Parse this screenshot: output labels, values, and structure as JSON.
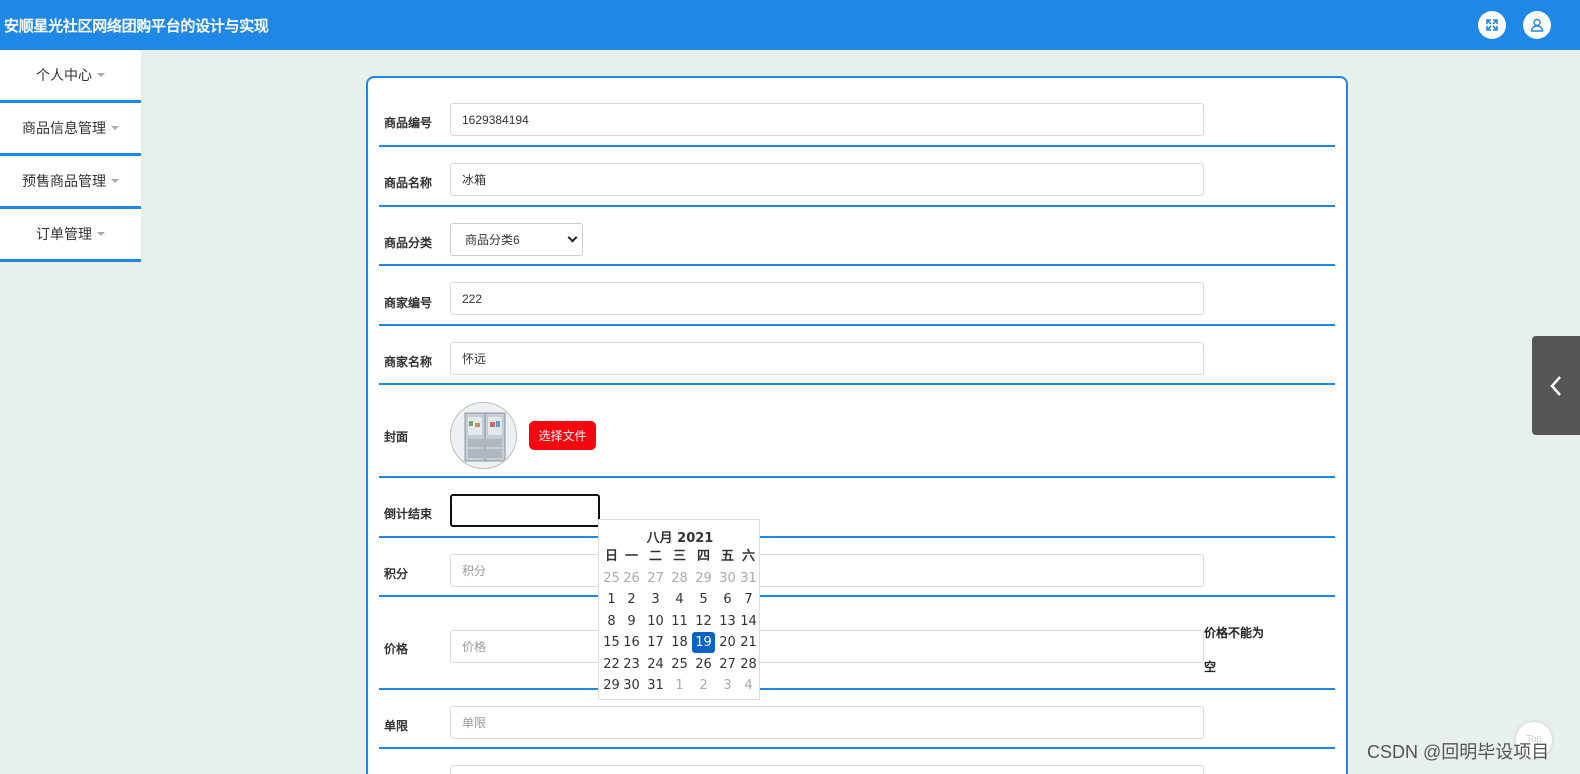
{
  "header": {
    "title": "安顺星光社区网络团购平台的设计与实现"
  },
  "sidebar": {
    "items": [
      {
        "label": "个人中心"
      },
      {
        "label": "商品信息管理"
      },
      {
        "label": "预售商品管理"
      },
      {
        "label": "订单管理"
      }
    ]
  },
  "form": {
    "product_code": {
      "label": "商品编号",
      "value": "1629384194"
    },
    "product_name": {
      "label": "商品名称",
      "value": "冰箱"
    },
    "category": {
      "label": "商品分类",
      "selected": "商品分类6"
    },
    "merchant_code": {
      "label": "商家编号",
      "value": "222"
    },
    "merchant_name": {
      "label": "商家名称",
      "value": "怀远"
    },
    "cover": {
      "label": "封面",
      "button_label": "选择文件"
    },
    "countdown": {
      "label": "倒计结束",
      "value": ""
    },
    "points": {
      "label": "积分",
      "placeholder": "积分"
    },
    "price": {
      "label": "价格",
      "placeholder": "价格",
      "error_line1": "价格不能为",
      "error_line2": "空"
    },
    "limit": {
      "label": "单限",
      "placeholder": "单限"
    }
  },
  "calendar": {
    "month_label": "八月 2021",
    "weekdays": [
      "日",
      "一",
      "二",
      "三",
      "四",
      "五",
      "六"
    ],
    "weeks": [
      [
        "25",
        "26",
        "27",
        "28",
        "29",
        "30",
        "31"
      ],
      [
        "1",
        "2",
        "3",
        "4",
        "5",
        "6",
        "7"
      ],
      [
        "8",
        "9",
        "10",
        "11",
        "12",
        "13",
        "14"
      ],
      [
        "15",
        "16",
        "17",
        "18",
        "19",
        "20",
        "21"
      ],
      [
        "22",
        "23",
        "24",
        "25",
        "26",
        "27",
        "28"
      ],
      [
        "29",
        "30",
        "31",
        "1",
        "2",
        "3",
        "4"
      ]
    ],
    "selected": "19",
    "selected_color": "#0a64c8"
  },
  "floating": {
    "top_label": "Top"
  },
  "watermark": "CSDN @回明毕设项目",
  "colors": {
    "primary": "#1f87e5",
    "danger": "#f5070f",
    "background": "#e8f0ec"
  }
}
